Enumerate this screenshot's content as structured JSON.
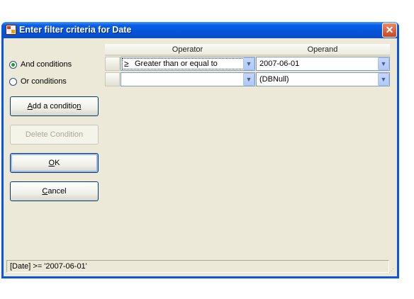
{
  "window": {
    "title": "Enter filter criteria for Date",
    "close_label": "✕"
  },
  "conditions": {
    "and_label": "And conditions",
    "or_label": "Or conditions",
    "selected": "and"
  },
  "buttons": {
    "add_prefix": "A",
    "add_rest": "dd a conditio",
    "add_underline2": "n",
    "delete": "Delete Condition",
    "ok_underline": "O",
    "ok_rest": "K",
    "cancel_underline": "C",
    "cancel_rest": "ancel"
  },
  "grid": {
    "columns": [
      "Operator",
      "Operand"
    ],
    "rows": [
      {
        "operator_symbol": "≥",
        "operator": "Greater than or equal to",
        "operand": "2007-06-01"
      },
      {
        "operator_symbol": "",
        "operator": "",
        "operand": "(DBNull)"
      }
    ]
  },
  "status": {
    "expression": "[Date] >= '2007-06-01'"
  },
  "icons": {
    "dropdown": "chevron-down-icon"
  }
}
